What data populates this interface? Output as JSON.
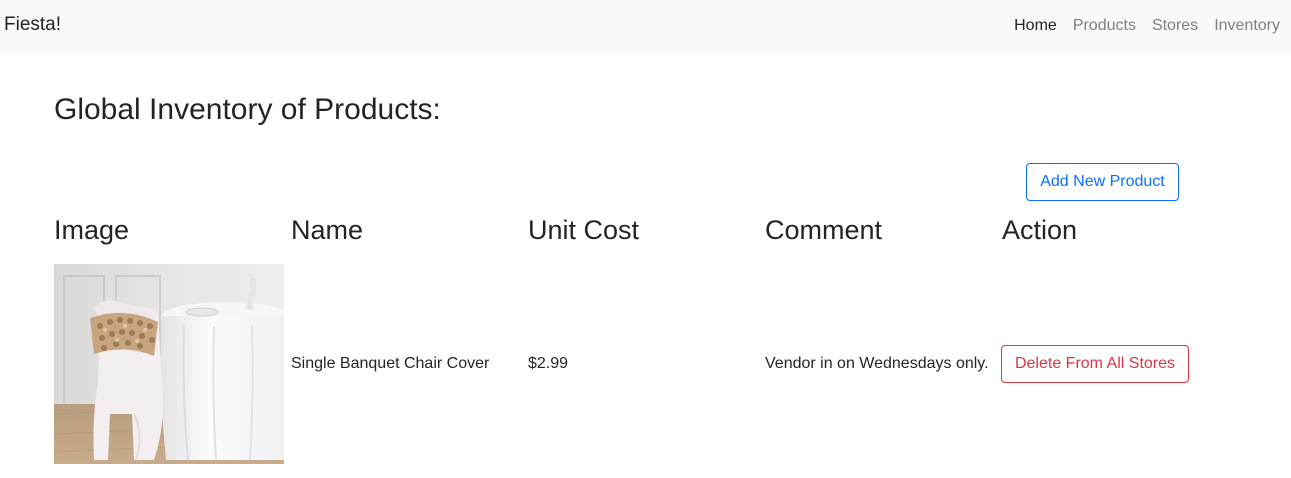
{
  "navbar": {
    "brand": "Fiesta!",
    "links": [
      {
        "label": "Home",
        "active": true
      },
      {
        "label": "Products",
        "active": false
      },
      {
        "label": "Stores",
        "active": false
      },
      {
        "label": "Inventory",
        "active": false
      }
    ]
  },
  "page": {
    "title": "Global Inventory of Products:",
    "add_button": "Add New Product"
  },
  "table": {
    "headers": [
      "Image",
      "Name",
      "Unit Cost",
      "Comment",
      "Action"
    ],
    "rows": [
      {
        "image": "product-photo",
        "name": "Single Banquet Chair Cover",
        "unit_cost": "$2.99",
        "comment": "Vendor in on Wednesdays only.",
        "action": "Delete From All Stores"
      }
    ]
  },
  "colors": {
    "navbar_bg": "#f8f9fa",
    "primary": "#0d6efd",
    "danger": "#dc3545",
    "muted_link": "#7d7f81",
    "text": "#212529"
  }
}
